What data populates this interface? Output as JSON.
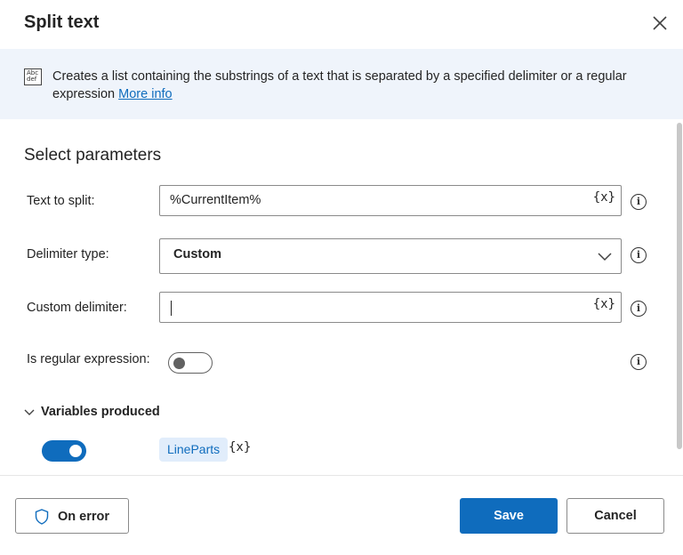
{
  "dialog": {
    "title": "Split text"
  },
  "banner": {
    "icon_name": "text-abc-icon",
    "icon_text": "Abc def",
    "description": "Creates a list containing the substrings of a text that is separated by a specified delimiter or a regular expression",
    "link_label": "More info"
  },
  "parameters": {
    "heading": "Select parameters",
    "text_to_split": {
      "label": "Text to split:",
      "value": "%CurrentItem%",
      "var_button": "{x}"
    },
    "delimiter_type": {
      "label": "Delimiter type:",
      "selected": "Custom"
    },
    "custom_delimiter": {
      "label": "Custom delimiter:",
      "value": "",
      "var_button": "{x}"
    },
    "is_regex": {
      "label": "Is regular expression:",
      "enabled": false
    }
  },
  "variables": {
    "heading": "Variables produced",
    "enabled": true,
    "name": "LineParts",
    "var_icon": "{x}"
  },
  "footer": {
    "on_error_label": "On error",
    "save_label": "Save",
    "cancel_label": "Cancel"
  },
  "colors": {
    "accent": "#0f6cbd",
    "banner_bg": "#eff4fb",
    "chip_bg": "#e1edfb"
  }
}
